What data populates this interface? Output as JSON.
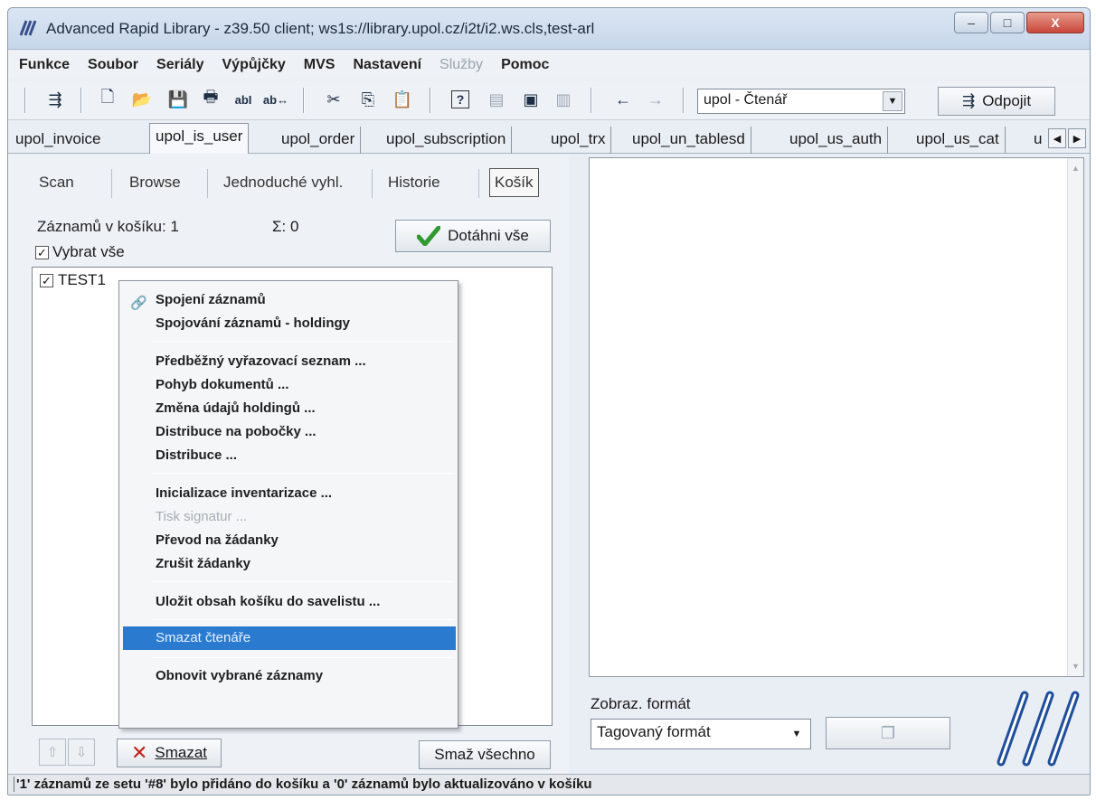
{
  "window": {
    "title": "Advanced Rapid Library - z39.50 client; ws1s://library.upol.cz/i2t/i2.ws.cls,test-arl",
    "minimize_glyph": "–",
    "maximize_glyph": "□",
    "close_glyph": "X"
  },
  "menu": [
    "Funkce",
    "Soubor",
    "Seriály",
    "Výpůjčky",
    "MVS",
    "Nastavení",
    "Služby",
    "Pomoc"
  ],
  "toolbar": {
    "role_combo_value": "upol - Čtenář",
    "disconnect_label": "Odpojit",
    "icons": {
      "connect": "⇶",
      "new": "🗋",
      "open": "📂",
      "save": "💾",
      "print": "🖶",
      "find": "abI",
      "replace": "ab↔",
      "cut": "✂",
      "copy": "⎘",
      "paste": "📋",
      "help": "?",
      "doc": "▤",
      "book": "▣",
      "frame": "▥",
      "back": "←",
      "forward": "→"
    }
  },
  "tabs": [
    "upol_invoice",
    "upol_is_user",
    "upol_order",
    "upol_subscription",
    "upol_trx",
    "upol_un_tablesd",
    "upol_us_auth",
    "upol_us_cat",
    "u"
  ],
  "active_tab": "upol_is_user",
  "subtabs": [
    "Scan",
    "Browse",
    "Jednoduché vyhl.",
    "Historie",
    "Košík"
  ],
  "cart": {
    "count_label": "Záznamů v košíku: 1",
    "sum_label": "Σ: 0",
    "fetch_all_label": "Dotáhni vše",
    "select_all_label": "Vybrat vše",
    "select_all_checked": "✓",
    "item_label": "TEST1",
    "item_checked": "✓",
    "delete_label": "Smazat",
    "delete_all_label": "Smaž všechno",
    "up_glyph": "⇧",
    "down_glyph": "⇩"
  },
  "context_menu": {
    "items": [
      {
        "label": "Spojení záznamů",
        "icon": "🔗"
      },
      {
        "label": "Spojování záznamů - holdingy"
      },
      {
        "label": "Předběžný vyřazovací seznam ..."
      },
      {
        "label": "Pohyb dokumentů ..."
      },
      {
        "label": "Změna údajů holdingů ..."
      },
      {
        "label": "Distribuce na pobočky ..."
      },
      {
        "label": "Distribuce ..."
      },
      {
        "label": "Inicializace inventarizace ..."
      },
      {
        "label": "Tisk signatur ...",
        "disabled": "true"
      },
      {
        "label": "Převod na žádanky"
      },
      {
        "label": "Zrušit žádanky"
      },
      {
        "label": "Uložit obsah košíku do savelistu ..."
      },
      {
        "label": "Smazat čtenáře",
        "selected": "true"
      },
      {
        "label": "Obnovit vybrané záznamy"
      }
    ]
  },
  "format": {
    "label": "Zobraz. formát",
    "value": "Tagovaný formát",
    "arrow_glyph": "▼"
  },
  "status": "'1' záznamů ze setu '#8' bylo přidáno do košíku a '0' záznamů bylo aktualizováno v košíku",
  "colors": {
    "accent": "#2a7bd0",
    "check_green": "#2f9a2f",
    "logo_blue": "#1f4e9a",
    "delete_red": "#c2241b"
  }
}
